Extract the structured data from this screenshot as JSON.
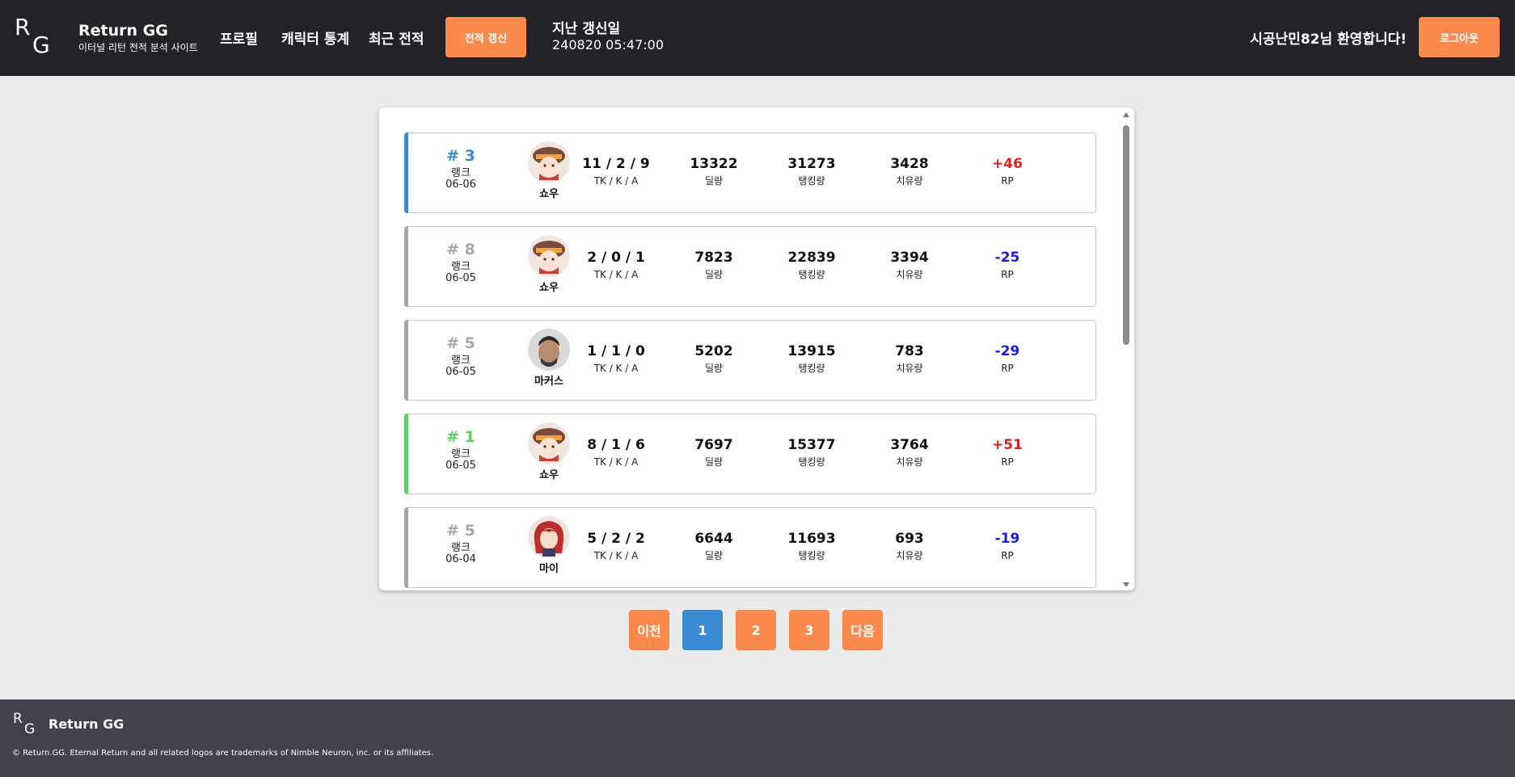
{
  "header": {
    "logo_r": "R",
    "logo_g": "G",
    "brand_name": "Return GG",
    "brand_sub": "이터널 리턴 전적 분석 사이트",
    "nav": {
      "profile": "프로필",
      "stats": "캐릭터 통계",
      "recent": "최근 전적"
    },
    "refresh_label": "전적 갱신",
    "last_update_label": "지난 갱신일",
    "last_update_value": "240820 05:47:00",
    "welcome": "시공난민82님 환영합니다!",
    "logout_label": "로그아웃"
  },
  "matches": [
    {
      "rank": "# 3",
      "mode": "랭크",
      "date": "06-06",
      "character": "쇼우",
      "kda": "11 / 2 / 9",
      "kda_label": "TK / K / A",
      "damage": "13322",
      "damage_label": "딜량",
      "tank": "31273",
      "tank_label": "탱킹량",
      "heal": "3428",
      "heal_label": "치유량",
      "rp": "+46",
      "rp_label": "RP",
      "accent": "#3b8bd4"
    },
    {
      "rank": "# 8",
      "mode": "랭크",
      "date": "06-05",
      "character": "쇼우",
      "kda": "2 / 0 / 1",
      "kda_label": "TK / K / A",
      "damage": "7823",
      "damage_label": "딜량",
      "tank": "22839",
      "tank_label": "탱킹량",
      "heal": "3394",
      "heal_label": "치유량",
      "rp": "-25",
      "rp_label": "RP",
      "accent": "#a7a7a7"
    },
    {
      "rank": "# 5",
      "mode": "랭크",
      "date": "06-05",
      "character": "마커스",
      "kda": "1 / 1 / 0",
      "kda_label": "TK / K / A",
      "damage": "5202",
      "damage_label": "딜량",
      "tank": "13915",
      "tank_label": "탱킹량",
      "heal": "783",
      "heal_label": "치유량",
      "rp": "-29",
      "rp_label": "RP",
      "accent": "#a7a7a7"
    },
    {
      "rank": "# 1",
      "mode": "랭크",
      "date": "06-05",
      "character": "쇼우",
      "kda": "8 / 1 / 6",
      "kda_label": "TK / K / A",
      "damage": "7697",
      "damage_label": "딜량",
      "tank": "15377",
      "tank_label": "탱킹량",
      "heal": "3764",
      "heal_label": "치유량",
      "rp": "+51",
      "rp_label": "RP",
      "accent": "#5fcf65"
    },
    {
      "rank": "# 5",
      "mode": "랭크",
      "date": "06-04",
      "character": "마이",
      "kda": "5 / 2 / 2",
      "kda_label": "TK / K / A",
      "damage": "6644",
      "damage_label": "딜량",
      "tank": "11693",
      "tank_label": "탱킹량",
      "heal": "693",
      "heal_label": "치유량",
      "rp": "-19",
      "rp_label": "RP",
      "accent": "#a7a7a7"
    }
  ],
  "pagination": {
    "prev": "이전",
    "p1": "1",
    "p2": "2",
    "p3": "3",
    "next": "다음"
  },
  "footer": {
    "logo_r": "R",
    "logo_g": "G",
    "name": "Return GG",
    "copyright": "© Return.GG. Eternal Return and all related logos are trademarks of Nimble Neuron, inc. or its affiliates."
  },
  "colors": {
    "header_bg": "#222326",
    "orange": "#fc8a4c",
    "blue": "#3b8bd4",
    "footer_bg": "#41434c",
    "rp_positive": "#e11d1d",
    "rp_negative": "#1a1ae6"
  }
}
